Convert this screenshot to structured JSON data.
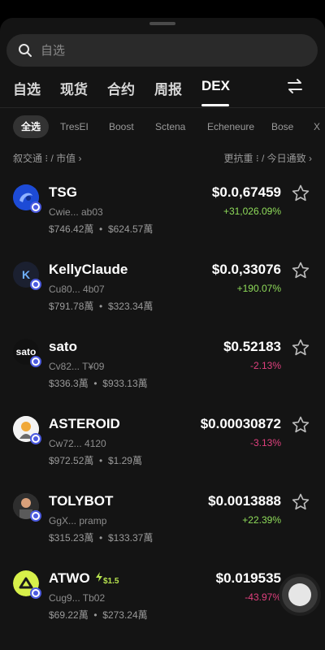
{
  "search": {
    "placeholder": "自选"
  },
  "tabs": [
    {
      "label": "自选"
    },
    {
      "label": "现货"
    },
    {
      "label": "合约"
    },
    {
      "label": "周报"
    },
    {
      "label": "DEX"
    }
  ],
  "active_tab": "DEX",
  "chips": [
    {
      "label": "全选"
    },
    {
      "label": "TresEI"
    },
    {
      "label": "Boost"
    },
    {
      "label": "Sctena"
    },
    {
      "label": "Echeneure"
    },
    {
      "label": "Bose"
    },
    {
      "label": "X"
    }
  ],
  "sort": {
    "left": "叙交通 ⁝ / 市值 ›",
    "right": "更抗重 ⁝ / 今日通致 ›"
  },
  "tokens": [
    {
      "name": "TSG",
      "address": "Cwie... ab03",
      "stat1": "$746.42萬",
      "stat2": "$624.57萬",
      "price": "$0.0,67459",
      "change": "+31,026.09%",
      "direction": "up",
      "avatar_text": "",
      "avatar_color": "#1d4bd6"
    },
    {
      "name": "KellyClaude",
      "address": "Cu80... 4b07",
      "stat1": "$791.78萬",
      "stat2": "$323.34萬",
      "price": "$0.0,33076",
      "change": "+190.07%",
      "direction": "up",
      "avatar_text": "K",
      "avatar_color": "#1b2030"
    },
    {
      "name": "sato",
      "address": "Cv82... T¥09",
      "stat1": "$336.3萬",
      "stat2": "$933.13萬",
      "price": "$0.52183",
      "change": "-2.13%",
      "direction": "down",
      "avatar_text": "sato",
      "avatar_color": "#111111"
    },
    {
      "name": "ASTEROID",
      "address": "Cw72... 4120",
      "stat1": "$972.52萬",
      "stat2": "$1.29萬",
      "price": "$0.00030872",
      "change": "-3.13%",
      "direction": "down",
      "avatar_text": "",
      "avatar_color": "#f3f3f3"
    },
    {
      "name": "TOLYBOT",
      "address": "GgX... pramp",
      "stat1": "$315.23萬",
      "stat2": "$133.37萬",
      "price": "$0.0013888",
      "change": "+22.39%",
      "direction": "up",
      "avatar_text": "",
      "avatar_color": "#3a3a3a"
    },
    {
      "name": "ATWO",
      "address": "Cug9... Tb02",
      "stat1": "$69.22萬",
      "stat2": "$273.24萬",
      "price": "$0.019535",
      "change": "-43.97%",
      "direction": "down",
      "avatar_text": "",
      "avatar_color": "#d7f04a",
      "tag": "$1.5"
    }
  ],
  "colors": {
    "up": "#8fdc5a",
    "down": "#e0407e",
    "sheet": "#141414"
  }
}
